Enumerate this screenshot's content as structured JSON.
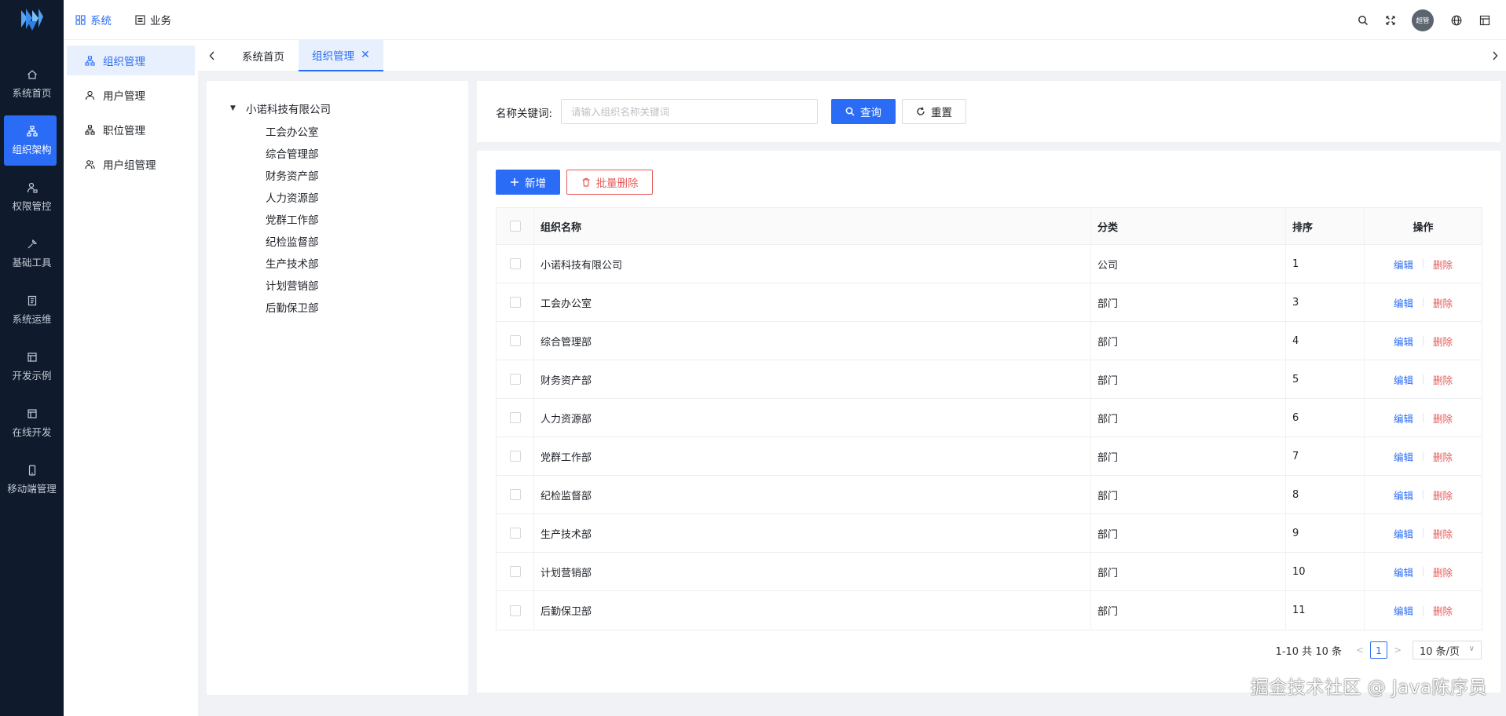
{
  "colors": {
    "primary": "#2b6cf6",
    "danger": "#e65b5b",
    "rail_bg": "#0f1a2c"
  },
  "rail": {
    "items": [
      {
        "label": "系统首页",
        "icon": "home-icon"
      },
      {
        "label": "组织架构",
        "icon": "org-chart-icon",
        "active": true
      },
      {
        "label": "权限管控",
        "icon": "user-lock-icon"
      },
      {
        "label": "基础工具",
        "icon": "wrench-icon"
      },
      {
        "label": "系统运维",
        "icon": "document-icon"
      },
      {
        "label": "开发示例",
        "icon": "window-icon"
      },
      {
        "label": "在线开发",
        "icon": "window-icon"
      },
      {
        "label": "移动端管理",
        "icon": "mobile-icon"
      }
    ]
  },
  "topnav": {
    "items": [
      {
        "label": "系统",
        "icon": "grid-icon",
        "active": true
      },
      {
        "label": "业务",
        "icon": "list-icon"
      }
    ]
  },
  "topbar": {
    "avatar_text": "超管"
  },
  "submenu": {
    "items": [
      {
        "label": "组织管理",
        "icon": "org-icon",
        "active": true
      },
      {
        "label": "用户管理",
        "icon": "user-icon"
      },
      {
        "label": "职位管理",
        "icon": "position-icon"
      },
      {
        "label": "用户组管理",
        "icon": "user-group-icon"
      }
    ]
  },
  "tabs": {
    "items": [
      {
        "label": "系统首页"
      },
      {
        "label": "组织管理",
        "active": true
      }
    ]
  },
  "tree": {
    "root": "小诺科技有限公司",
    "children": [
      "工会办公室",
      "综合管理部",
      "财务资产部",
      "人力资源部",
      "党群工作部",
      "纪检监督部",
      "生产技术部",
      "计划营销部",
      "后勤保卫部"
    ]
  },
  "search": {
    "label": "名称关键词:",
    "placeholder": "请输入组织名称关键词",
    "value": "",
    "query_label": "查询",
    "reset_label": "重置"
  },
  "toolbar": {
    "add_label": "新增",
    "batch_delete_label": "批量删除"
  },
  "table": {
    "headers": {
      "name": "组织名称",
      "type": "分类",
      "sort": "排序",
      "ops": "操作"
    },
    "edit_label": "编辑",
    "delete_label": "删除",
    "rows": [
      {
        "name": "小诺科技有限公司",
        "type": "公司",
        "sort": "1"
      },
      {
        "name": "工会办公室",
        "type": "部门",
        "sort": "3"
      },
      {
        "name": "综合管理部",
        "type": "部门",
        "sort": "4"
      },
      {
        "name": "财务资产部",
        "type": "部门",
        "sort": "5"
      },
      {
        "name": "人力资源部",
        "type": "部门",
        "sort": "6"
      },
      {
        "name": "党群工作部",
        "type": "部门",
        "sort": "7"
      },
      {
        "name": "纪检监督部",
        "type": "部门",
        "sort": "8"
      },
      {
        "name": "生产技术部",
        "type": "部门",
        "sort": "9"
      },
      {
        "name": "计划营销部",
        "type": "部门",
        "sort": "10"
      },
      {
        "name": "后勤保卫部",
        "type": "部门",
        "sort": "11"
      }
    ]
  },
  "pager": {
    "summary": "1-10 共 10 条",
    "current": "1",
    "page_size": "10 条/页"
  },
  "watermark": "掘金技术社区 @ Java陈序员"
}
